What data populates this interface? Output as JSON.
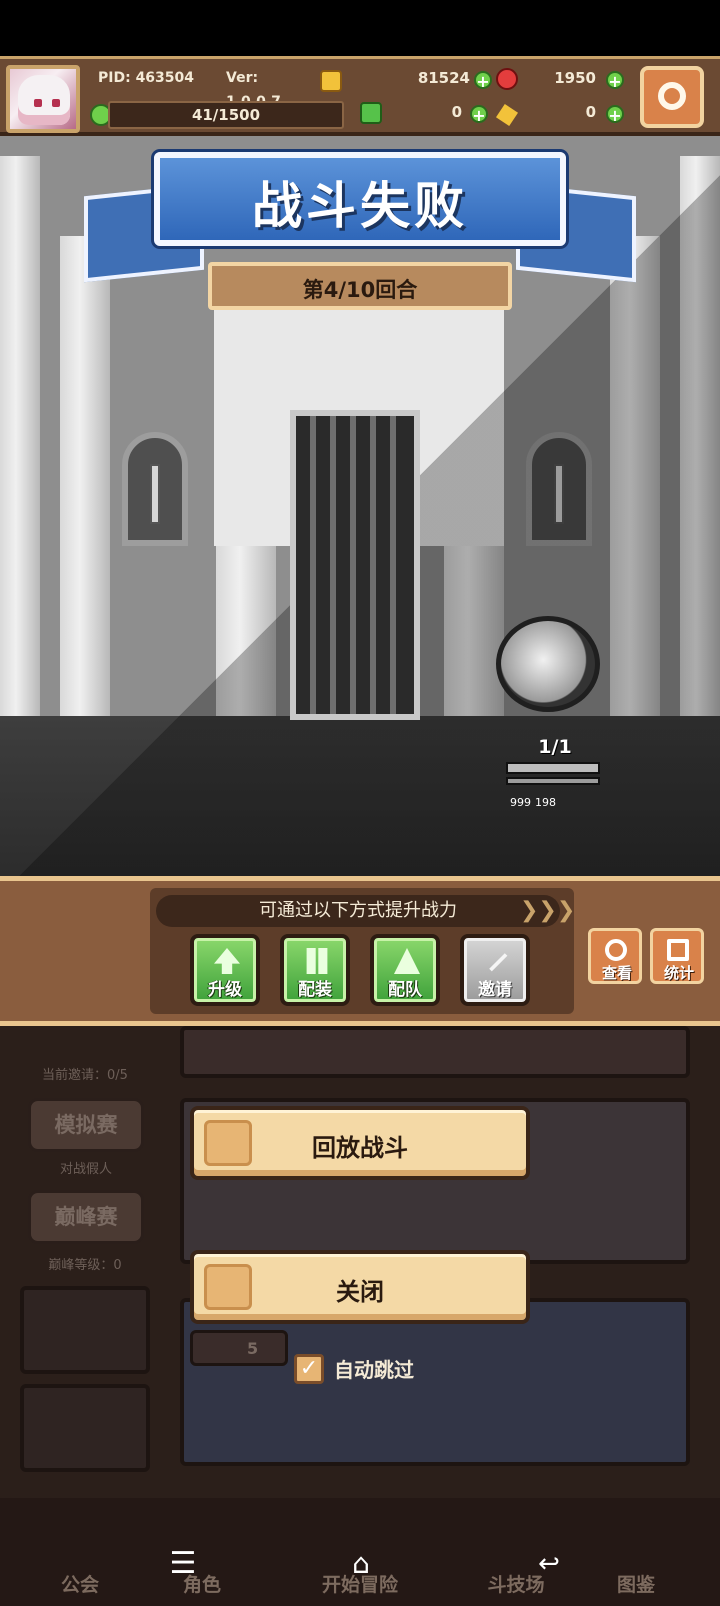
{
  "topbar": {
    "pid": "PID: 463504",
    "version": "Ver: 1.0.0.7",
    "gold": "81524",
    "gems": "1950",
    "energy": "41/1500",
    "clover": "0",
    "ticket": "0"
  },
  "banner": {
    "title": "战斗失败",
    "round": "第4/10回合"
  },
  "enemy": {
    "count": "1/1",
    "stat_hp": "999",
    "stat_atk": "198"
  },
  "improve": {
    "hint": "可通过以下方式提升战力",
    "buttons": [
      "升级",
      "配装",
      "配队",
      "邀请"
    ],
    "view": "查看",
    "stats": "统计"
  },
  "dialog": {
    "replay": "回放战斗",
    "close": "关闭",
    "auto_skip": "自动跳过"
  },
  "lobby": {
    "invite_count": "当前邀请：0/5",
    "sim_match": "模拟赛",
    "sim_sub": "对战假人",
    "peak_match": "巅峰赛",
    "peak_sub": "巅峰等级：0",
    "cost": "5"
  },
  "nav": [
    "公会",
    "角色",
    "开始冒险",
    "斗技场",
    "图鉴"
  ],
  "colors": {
    "banner_blue": "#2f67b9",
    "panel_brown": "#8a5d3e",
    "button_cream": "#f4d9a6",
    "accent_green": "#3ea13a"
  }
}
